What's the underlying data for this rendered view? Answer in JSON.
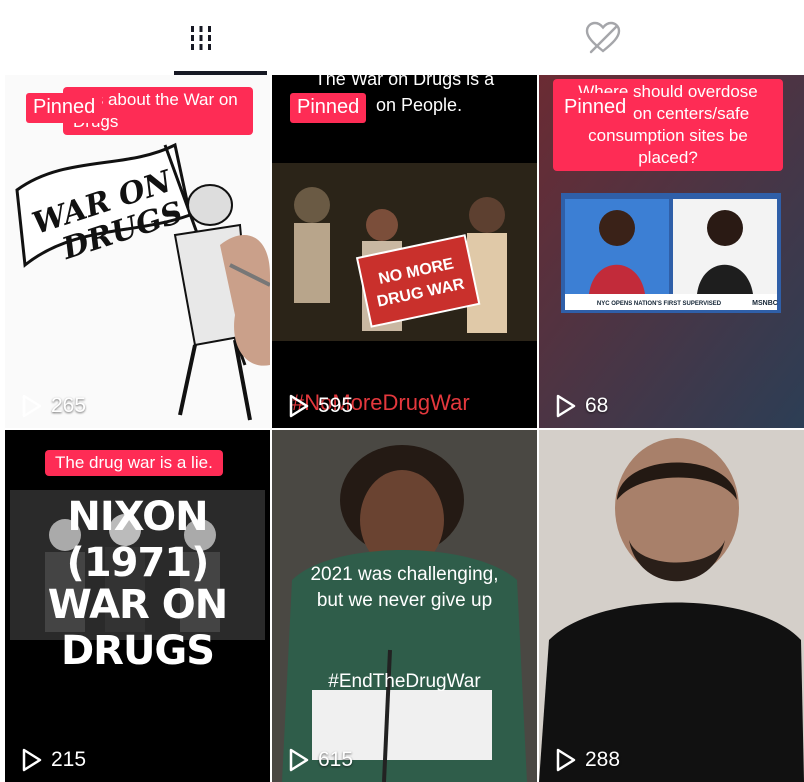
{
  "tabs": [
    {
      "name": "videos",
      "icon": "grid-icon",
      "active": true
    },
    {
      "name": "liked",
      "icon": "liked-hidden-icon",
      "active": false
    }
  ],
  "pinned_label": "Pinned",
  "videos": [
    {
      "caption": "Pinned Talks about the War on Drugs",
      "visible_caption": "alks about the War on Drugs",
      "views": "265"
    },
    {
      "caption": "The War on Drugs is a War on People.",
      "visible_caption_top": "The War on Drugs is a",
      "visible_caption_2": "on People.",
      "sign_text": "NO MORE DRUG WAR",
      "hashtag": "#NoMoreDrugWar",
      "views": "595"
    },
    {
      "caption": "Where should overdose prevention centers/safe consumption sites be placed?",
      "visible_caption_top": "Where should overdose",
      "visible_caption_2": "on centers/safe",
      "visible_caption_3": "consumption sites be",
      "visible_caption_4": "placed?",
      "tv_banner": "NYC OPENS NATION'S FIRST SUPERVISED DRUG-INJECTION SITES",
      "tv_network": "MSNBC",
      "views": "68"
    },
    {
      "caption": "The drug war is a lie.",
      "title_1": "NIXON (1971)",
      "title_2": "WAR ON DRUGS",
      "views": "215"
    },
    {
      "caption_line1": "2021 was challenging,",
      "caption_line2": "but we never give up",
      "hashtag": "#EndTheDrugWar",
      "views": "615"
    },
    {
      "views": "288"
    }
  ]
}
